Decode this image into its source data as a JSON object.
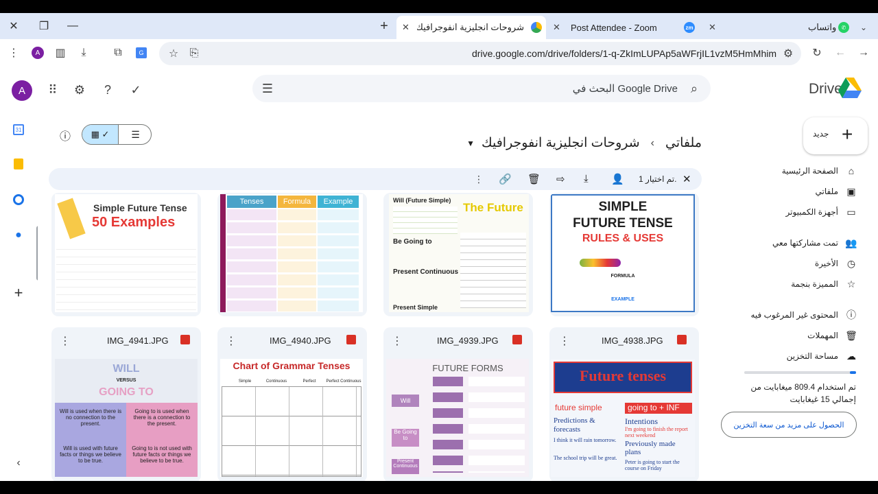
{
  "tabs": [
    {
      "title": "شروحات انجليزية انفوجرافيك - ive",
      "active": true
    },
    {
      "title": "Post Attendee - Zoom",
      "active": false
    },
    {
      "title": "واتساب",
      "active": false
    }
  ],
  "url": "drive.google.com/drive/folders/1-q-ZkImLUPAp5aWFrjIL1vzM5HmMhim",
  "avatar_letter": "A",
  "search_placeholder": "البحث في Google Drive",
  "logo": "Drive",
  "new_label": "جديد",
  "nav": {
    "home": "الصفحة الرئيسية",
    "my_files": "ملفاتي",
    "computers": "أجهزة الكمبيوتر",
    "shared": "تمت مشاركتها معي",
    "recent": "الأخيرة",
    "starred": "المميزة بنجمة",
    "spam": "المحتوى غير المرغوب فيه",
    "trash": "المهملات",
    "storage": "مساحة التخزين"
  },
  "storage_text_1": "تم استخدام 809.4 ميغابايت من",
  "storage_text_2": "إجمالي 15 غيغابايت",
  "storage_fraction": 0.053,
  "storage_button": "الحصول على مزيد من سعة التخزين",
  "breadcrumb": {
    "root": "ملفاتي",
    "sep": "›",
    "folder": "شروحات انجليزية انفوجرافيك"
  },
  "selection": "تم اختيار 1.",
  "files_row2": [
    "IMG_4941.JPG",
    "IMG_4940.JPG",
    "IMG_4939.JPG",
    "IMG_4938.JPG"
  ],
  "thumbs": {
    "t1_title": "Simple Future Tense",
    "t1_sub": "50 Examples",
    "t2_cols": [
      "Tenses",
      "Formula",
      "Example"
    ],
    "t3_a": "Will (Future Simple)",
    "t3_b": "The Future",
    "t3_c": "Be Going to",
    "t3_d": "Present Continuous",
    "t3_e": "Present Simple",
    "t4_a": "SIMPLE",
    "t4_b": "FUTURE TENSE",
    "t4_c": "RULES & USES",
    "t4_d": "FORMULA",
    "t4_e": "EXAMPLE",
    "t5_a": "WILL",
    "t5_b": "VERSUS",
    "t5_c": "GOING TO",
    "t5_d": "Will is used when there is no connection to the present.",
    "t5_e": "Going to is used when there is a connection to the present.",
    "t5_f": "Will is used with future facts or things we believe to be true.",
    "t5_g": "Going to is not used with future facts or things we believe to be true.",
    "t6_title": "Chart of Grammar Tenses",
    "t6_cols": [
      "Simple",
      "Continuous",
      "Perfect",
      "Perfect Continuous"
    ],
    "t7_title": "FUTURE FORMS",
    "t7_a": "Will",
    "t7_b": "Be Going to",
    "t7_c": "Present Continuous",
    "t8_title": "Future tenses",
    "t8_a": "future simple",
    "t8_b": "going to + INF",
    "t8_c": "Predictions & forecasts",
    "t8_d": "Intentions",
    "t8_e": "I think it will rain tomorrow.",
    "t8_f": "I'm going to finish the report next weekend",
    "t8_g": "Previously made plans",
    "t8_h": "The school trip will be great.",
    "t8_i": "Peter is going to start the course on Friday"
  }
}
